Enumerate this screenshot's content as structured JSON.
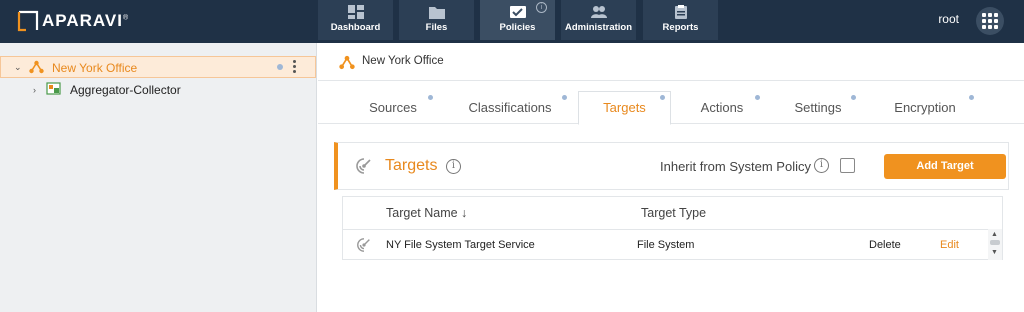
{
  "brand": {
    "name": "APARAVI",
    "mark": "®"
  },
  "nav": [
    {
      "label": "Dashboard",
      "icon": "dashboard-icon"
    },
    {
      "label": "Files",
      "icon": "folder-icon"
    },
    {
      "label": "Policies",
      "icon": "policy-icon",
      "active": true,
      "info": "i"
    },
    {
      "label": "Administration",
      "icon": "users-icon"
    },
    {
      "label": "Reports",
      "icon": "clipboard-icon"
    }
  ],
  "user": {
    "name": "root"
  },
  "tree": [
    {
      "label": "New York Office",
      "selected": true
    },
    {
      "label": "Aggregator-Collector"
    }
  ],
  "breadcrumb": {
    "label": "New York Office"
  },
  "tabs": [
    "Sources",
    "Classifications",
    "Targets",
    "Actions",
    "Settings",
    "Encryption"
  ],
  "panel": {
    "title": "Targets",
    "info": "i",
    "inherit_label": "Inherit from System Policy",
    "add_button": "Add Target"
  },
  "table": {
    "columns": [
      "Target Name ↓",
      "Target Type"
    ],
    "rows": [
      {
        "name": "NY File System Target Service",
        "type": "File System",
        "delete": "Delete",
        "edit": "Edit"
      }
    ]
  },
  "colors": {
    "accent": "#f0921f",
    "topbar": "#1f3146",
    "tab_dot": "#9fb7d6"
  }
}
